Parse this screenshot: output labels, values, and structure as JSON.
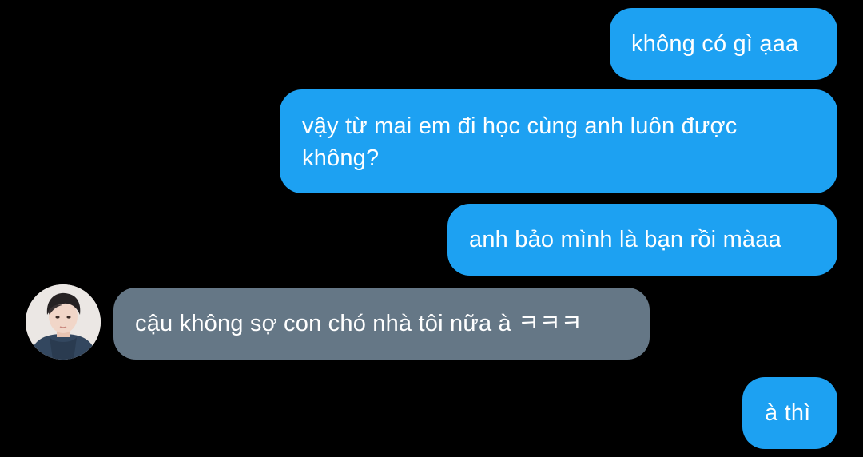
{
  "conversation": {
    "messages": [
      {
        "sender": "me",
        "text": "không có gì ạaa"
      },
      {
        "sender": "me",
        "text": "vậy từ mai em đi học cùng anh luôn được không?"
      },
      {
        "sender": "me",
        "text": "anh bảo mình là bạn rồi màaa"
      },
      {
        "sender": "other",
        "text": "cậu không sợ con chó nhà tôi nữa à ㅋㅋㅋ"
      },
      {
        "sender": "me",
        "text": "à thì"
      }
    ]
  },
  "colors": {
    "background": "#000000",
    "outgoing_bubble": "#1da1f2",
    "incoming_bubble": "#657786",
    "text": "#ffffff"
  },
  "icons": {
    "avatar": "profile-photo"
  }
}
